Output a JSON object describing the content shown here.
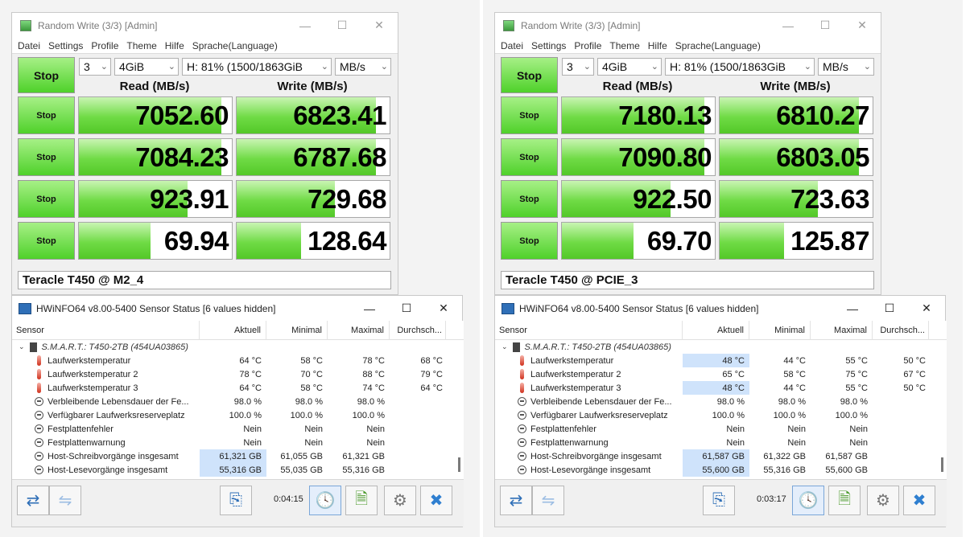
{
  "left": {
    "cdm": {
      "title": "Random Write (3/3) [Admin]",
      "menu": [
        "Datei",
        "Settings",
        "Profile",
        "Theme",
        "Hilfe",
        "Sprache(Language)"
      ],
      "stop_label": "Stop",
      "count": "3",
      "size": "4GiB",
      "drive": "H: 81% (1500/1863GiB",
      "unit": "MB/s",
      "read_header": "Read (MB/s)",
      "write_header": "Write (MB/s)",
      "rows": [
        {
          "stop": "Stop",
          "read": "7052.60",
          "read_fill": 0.93,
          "write": "6823.41",
          "write_fill": 0.91
        },
        {
          "stop": "Stop",
          "read": "7084.23",
          "read_fill": 0.93,
          "write": "6787.68",
          "write_fill": 0.91
        },
        {
          "stop": "Stop",
          "read": "923.91",
          "read_fill": 0.71,
          "write": "729.68",
          "write_fill": 0.64
        },
        {
          "stop": "Stop",
          "read": "69.94",
          "read_fill": 0.47,
          "write": "128.64",
          "write_fill": 0.42
        }
      ],
      "drive_label": "Teracle T450 @ M2_4"
    },
    "hw": {
      "title": "HWiNFO64 v8.00-5400 Sensor Status [6 values hidden]",
      "headers": {
        "sensor": "Sensor",
        "current": "Aktuell",
        "min": "Minimal",
        "max": "Maximal",
        "avg": "Durchsch..."
      },
      "group": "S.M.A.R.T.: T450-2TB (454UA03865)",
      "rows": [
        {
          "icon": "thermometer-icon",
          "name": "Laufwerkstemperatur",
          "cur": "64 °C",
          "min": "58 °C",
          "max": "78 °C",
          "avg": "68 °C",
          "hl": false
        },
        {
          "icon": "thermometer-icon",
          "name": "Laufwerkstemperatur 2",
          "cur": "78 °C",
          "min": "70 °C",
          "max": "88 °C",
          "avg": "79 °C",
          "hl": false
        },
        {
          "icon": "thermometer-icon",
          "name": "Laufwerkstemperatur 3",
          "cur": "64 °C",
          "min": "58 °C",
          "max": "74 °C",
          "avg": "64 °C",
          "hl": false
        },
        {
          "icon": "gauge-icon",
          "name": "Verbleibende Lebensdauer der Fe...",
          "cur": "98.0 %",
          "min": "98.0 %",
          "max": "98.0 %",
          "avg": "",
          "hl": false
        },
        {
          "icon": "gauge-icon",
          "name": "Verfügbarer Laufwerksreserveplatz",
          "cur": "100.0 %",
          "min": "100.0 %",
          "max": "100.0 %",
          "avg": "",
          "hl": false
        },
        {
          "icon": "gauge-icon",
          "name": "Festplattenfehler",
          "cur": "Nein",
          "min": "Nein",
          "max": "Nein",
          "avg": "",
          "hl": false
        },
        {
          "icon": "gauge-icon",
          "name": "Festplattenwarnung",
          "cur": "Nein",
          "min": "Nein",
          "max": "Nein",
          "avg": "",
          "hl": false
        },
        {
          "icon": "gauge-icon",
          "name": "Host-Schreibvorgänge insgesamt",
          "cur": "61,321 GB",
          "min": "61,055 GB",
          "max": "61,321 GB",
          "avg": "",
          "hl": true
        },
        {
          "icon": "gauge-icon",
          "name": "Host-Lesevorgänge insgesamt",
          "cur": "55,316 GB",
          "min": "55,035 GB",
          "max": "55,316 GB",
          "avg": "",
          "hl": true
        }
      ],
      "timer": "0:04:15"
    }
  },
  "right": {
    "cdm": {
      "title": "Random Write (3/3) [Admin]",
      "menu": [
        "Datei",
        "Settings",
        "Profile",
        "Theme",
        "Hilfe",
        "Sprache(Language)"
      ],
      "stop_label": "Stop",
      "count": "3",
      "size": "4GiB",
      "drive": "H: 81% (1500/1863GiB",
      "unit": "MB/s",
      "read_header": "Read (MB/s)",
      "write_header": "Write (MB/s)",
      "rows": [
        {
          "stop": "Stop",
          "read": "7180.13",
          "read_fill": 0.93,
          "write": "6810.27",
          "write_fill": 0.91
        },
        {
          "stop": "Stop",
          "read": "7090.80",
          "read_fill": 0.93,
          "write": "6803.05",
          "write_fill": 0.91
        },
        {
          "stop": "Stop",
          "read": "922.50",
          "read_fill": 0.71,
          "write": "723.63",
          "write_fill": 0.64
        },
        {
          "stop": "Stop",
          "read": "69.70",
          "read_fill": 0.47,
          "write": "125.87",
          "write_fill": 0.42
        }
      ],
      "drive_label": "Teracle T450 @ PCIE_3"
    },
    "hw": {
      "title": "HWiNFO64 v8.00-5400 Sensor Status [6 values hidden]",
      "headers": {
        "sensor": "Sensor",
        "current": "Aktuell",
        "min": "Minimal",
        "max": "Maximal",
        "avg": "Durchsch..."
      },
      "group": "S.M.A.R.T.: T450-2TB (454UA03865)",
      "rows": [
        {
          "icon": "thermometer-icon",
          "name": "Laufwerkstemperatur",
          "cur": "48 °C",
          "min": "44 °C",
          "max": "55 °C",
          "avg": "50 °C",
          "hl": true
        },
        {
          "icon": "thermometer-icon",
          "name": "Laufwerkstemperatur 2",
          "cur": "65 °C",
          "min": "58 °C",
          "max": "75 °C",
          "avg": "67 °C",
          "hl": false
        },
        {
          "icon": "thermometer-icon",
          "name": "Laufwerkstemperatur 3",
          "cur": "48 °C",
          "min": "44 °C",
          "max": "55 °C",
          "avg": "50 °C",
          "hl": true
        },
        {
          "icon": "gauge-icon",
          "name": "Verbleibende Lebensdauer der Fe...",
          "cur": "98.0 %",
          "min": "98.0 %",
          "max": "98.0 %",
          "avg": "",
          "hl": false
        },
        {
          "icon": "gauge-icon",
          "name": "Verfügbarer Laufwerksreserveplatz",
          "cur": "100.0 %",
          "min": "100.0 %",
          "max": "100.0 %",
          "avg": "",
          "hl": false
        },
        {
          "icon": "gauge-icon",
          "name": "Festplattenfehler",
          "cur": "Nein",
          "min": "Nein",
          "max": "Nein",
          "avg": "",
          "hl": false
        },
        {
          "icon": "gauge-icon",
          "name": "Festplattenwarnung",
          "cur": "Nein",
          "min": "Nein",
          "max": "Nein",
          "avg": "",
          "hl": false
        },
        {
          "icon": "gauge-icon",
          "name": "Host-Schreibvorgänge insgesamt",
          "cur": "61,587 GB",
          "min": "61,322 GB",
          "max": "61,587 GB",
          "avg": "",
          "hl": true
        },
        {
          "icon": "gauge-icon",
          "name": "Host-Lesevorgänge insgesamt",
          "cur": "55,600 GB",
          "min": "55,316 GB",
          "max": "55,600 GB",
          "avg": "",
          "hl": true
        }
      ],
      "timer": "0:03:17"
    }
  }
}
